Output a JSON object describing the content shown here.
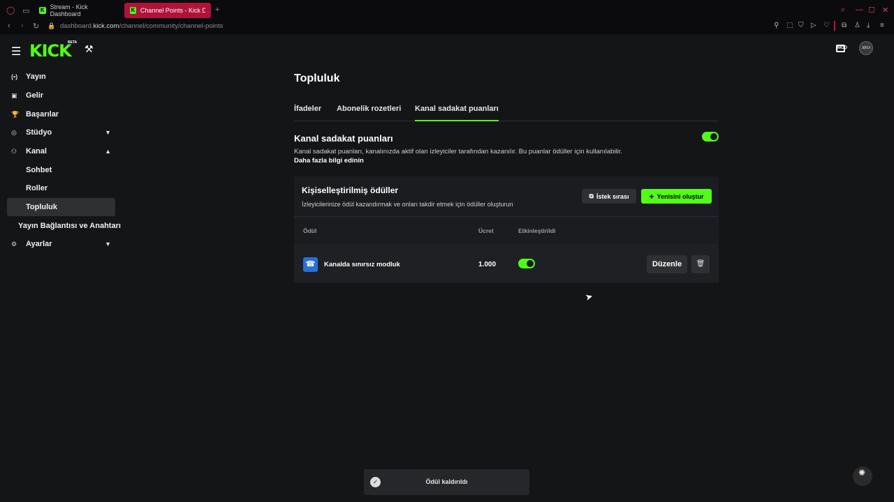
{
  "browser": {
    "tabs": [
      {
        "label": "Stream - Kick Dashboard"
      },
      {
        "label": "Channel Points - Kick Das"
      }
    ],
    "new_tab": "+",
    "url_prefix": "dashboard.",
    "url_domain": "kick.com",
    "url_path": "/channel/community/channel-points"
  },
  "app": {
    "logo": "KICK",
    "logo_badge": "BETA",
    "mod_icon_text": "MOD",
    "avatar_text": "JØSX"
  },
  "sidebar": {
    "items": [
      {
        "label": "Yayın",
        "icon": "broadcast-icon",
        "glyph": "(•)"
      },
      {
        "label": "Gelir",
        "icon": "revenue-icon",
        "glyph": "▣"
      },
      {
        "label": "Başarılar",
        "icon": "trophy-icon",
        "glyph": "🏆"
      },
      {
        "label": "Stüdyo",
        "icon": "studio-icon",
        "glyph": "◎"
      },
      {
        "label": "Kanal",
        "icon": "channel-icon",
        "glyph": "⚇"
      },
      {
        "label": "Sohbet"
      },
      {
        "label": "Roller"
      },
      {
        "label": "Topluluk"
      },
      {
        "label": "Yayın Bağlantısı ve Anahtarı"
      },
      {
        "label": "Ayarlar",
        "icon": "settings-icon",
        "glyph": "⚙"
      }
    ]
  },
  "main": {
    "title": "Topluluk",
    "tabs": [
      {
        "label": "İfadeler"
      },
      {
        "label": "Abonelik rozetleri"
      },
      {
        "label": "Kanal sadakat puanları"
      }
    ],
    "section": {
      "title": "Kanal sadakat puanları",
      "description": "Kanal sadakat puanları, kanalınızda aktif olan izleyiciler tarafından kazanılır. Bu puanlar ödüller için kullanılabilir.",
      "link": "Daha fazla bilgi edinin",
      "enabled": true
    },
    "rewards": {
      "title": "Kişiselleştirilmiş ödüller",
      "description": "İzleyicilerinize ödül kazandırmak ve onları takdir etmek için ödüller oluşturun",
      "queue_button": "İstek sırası",
      "new_button": "Yenisini oluştur",
      "columns": {
        "reward": "Ödül",
        "cost": "Ücret",
        "enabled": "Etkinleştirildi"
      },
      "rows": [
        {
          "name": "Kanalda sınırsız modluk",
          "cost": "1.000",
          "enabled": true,
          "edit": "Düzenle"
        }
      ]
    }
  },
  "toast": {
    "text": "Ödül kaldırıldı"
  },
  "colors": {
    "accent": "#53fc18",
    "active_tab": "#b0123a",
    "background": "#141517"
  }
}
